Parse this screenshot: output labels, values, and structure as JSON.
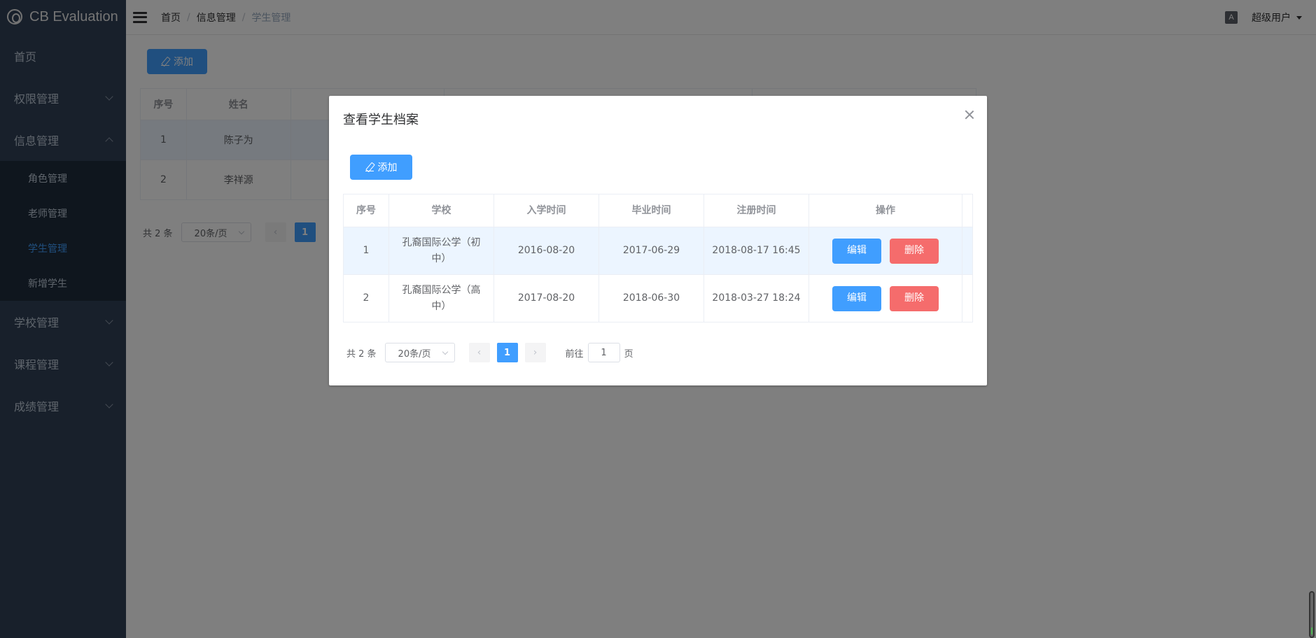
{
  "app": {
    "title": "CB Evaluation"
  },
  "sidebar": {
    "items": [
      {
        "label": "首页"
      },
      {
        "label": "权限管理"
      },
      {
        "label": "信息管理"
      },
      {
        "label": "学校管理"
      },
      {
        "label": "课程管理"
      },
      {
        "label": "成绩管理"
      }
    ],
    "submenu": [
      {
        "label": "角色管理"
      },
      {
        "label": "老师管理"
      },
      {
        "label": "学生管理"
      },
      {
        "label": "新增学生"
      }
    ]
  },
  "header": {
    "breadcrumb": [
      "首页",
      "信息管理",
      "学生管理"
    ],
    "separator": "/",
    "lang_icon": "A",
    "user": "超级用户"
  },
  "page": {
    "add_label": "添加",
    "table": {
      "columns": [
        "序号",
        "姓名"
      ],
      "rows": [
        {
          "index": "1",
          "name": "陈子为"
        },
        {
          "index": "2",
          "name": "李祥源"
        }
      ]
    },
    "pager": {
      "total": "共 2 条",
      "page_size": "20条/页",
      "current": "1"
    }
  },
  "dialog": {
    "title": "查看学生档案",
    "add_label": "添加",
    "table": {
      "columns": [
        "序号",
        "学校",
        "入学时间",
        "毕业时间",
        "注册时间",
        "操作"
      ],
      "rows": [
        {
          "index": "1",
          "school": "孔裔国际公学（初中）",
          "enroll": "2016-08-20",
          "graduate": "2017-06-29",
          "register": "2018-08-17 16:45"
        },
        {
          "index": "2",
          "school": "孔裔国际公学（高中）",
          "enroll": "2017-08-20",
          "graduate": "2018-06-30",
          "register": "2018-03-27 18:24"
        }
      ],
      "edit_label": "编辑",
      "delete_label": "删除"
    },
    "pager": {
      "total": "共 2 条",
      "page_size": "20条/页",
      "current": "1",
      "goto_prefix": "前往",
      "goto_value": "1",
      "goto_suffix": "页"
    }
  }
}
